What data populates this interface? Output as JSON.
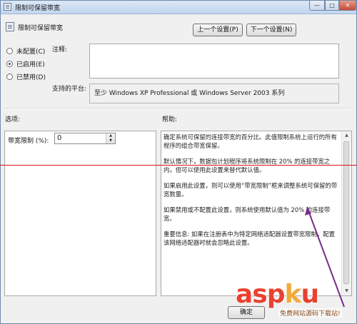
{
  "window": {
    "title": "限制可保留带宽",
    "controls": {
      "minimize": "—",
      "maximize": "□",
      "close": "✕"
    }
  },
  "header": {
    "setting_name": "限制可保留带宽",
    "prev_button": "上一个设置(P)",
    "next_button": "下一个设置(N)"
  },
  "state_options": [
    {
      "label": "未配置(C)",
      "selected": false
    },
    {
      "label": "已启用(E)",
      "selected": true
    },
    {
      "label": "已禁用(D)",
      "selected": false
    }
  ],
  "comment": {
    "label": "注释:",
    "value": ""
  },
  "platform": {
    "label": "支持的平台:",
    "value": "至少 Windows XP Professional 或 Windows Server 2003 系列"
  },
  "options": {
    "heading": "选项:",
    "bandwidth_label": "带宽限制 (%):",
    "bandwidth_value": "0"
  },
  "help": {
    "heading": "帮助:",
    "paragraphs": [
      "确定系统可保留的连接带宽的百分比。此值限制系统上运行的所有程序的组合带宽保留。",
      "默认情况下，数据包计划程序将系统限制在 20% 的连接带宽之内，但可以使用此设置来替代默认值。",
      "如果启用此设置，则可以使用“带宽限制”框来调整系统可保留的带宽数量。",
      "如果禁用或不配置此设置，则系统使用默认值为 20% 的连接带宽。",
      "重要信息: 如果在注册表中为特定网络适配器设置带宽限制，配置该网络适配器时就会忽略此设置。"
    ]
  },
  "footer": {
    "ok_button": "确定"
  },
  "watermark": {
    "logo_left": "asp",
    "logo_o": "k",
    "logo_right": "u",
    "logo_suffix": ".com",
    "subtitle": "免费网站源码下载站!"
  },
  "annotation_colors": {
    "line": "#d8141c",
    "arrow": "#7a2a8a"
  },
  "icons": {
    "title_icon": "policy-icon",
    "header_icon": "policy-icon"
  }
}
